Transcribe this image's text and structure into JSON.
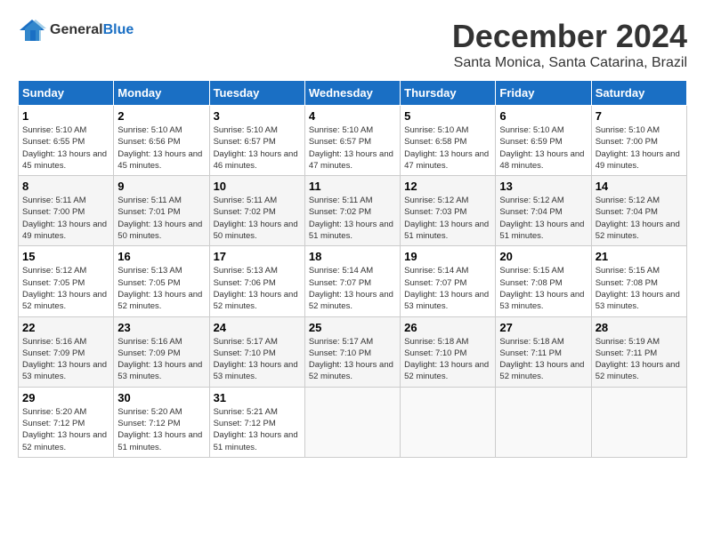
{
  "header": {
    "logo_general": "General",
    "logo_blue": "Blue",
    "title": "December 2024",
    "location": "Santa Monica, Santa Catarina, Brazil"
  },
  "calendar": {
    "days_of_week": [
      "Sunday",
      "Monday",
      "Tuesday",
      "Wednesday",
      "Thursday",
      "Friday",
      "Saturday"
    ],
    "weeks": [
      [
        {
          "day": "1",
          "sunrise": "5:10 AM",
          "sunset": "6:55 PM",
          "daylight": "13 hours and 45 minutes."
        },
        {
          "day": "2",
          "sunrise": "5:10 AM",
          "sunset": "6:56 PM",
          "daylight": "13 hours and 45 minutes."
        },
        {
          "day": "3",
          "sunrise": "5:10 AM",
          "sunset": "6:57 PM",
          "daylight": "13 hours and 46 minutes."
        },
        {
          "day": "4",
          "sunrise": "5:10 AM",
          "sunset": "6:57 PM",
          "daylight": "13 hours and 47 minutes."
        },
        {
          "day": "5",
          "sunrise": "5:10 AM",
          "sunset": "6:58 PM",
          "daylight": "13 hours and 47 minutes."
        },
        {
          "day": "6",
          "sunrise": "5:10 AM",
          "sunset": "6:59 PM",
          "daylight": "13 hours and 48 minutes."
        },
        {
          "day": "7",
          "sunrise": "5:10 AM",
          "sunset": "7:00 PM",
          "daylight": "13 hours and 49 minutes."
        }
      ],
      [
        {
          "day": "8",
          "sunrise": "5:11 AM",
          "sunset": "7:00 PM",
          "daylight": "13 hours and 49 minutes."
        },
        {
          "day": "9",
          "sunrise": "5:11 AM",
          "sunset": "7:01 PM",
          "daylight": "13 hours and 50 minutes."
        },
        {
          "day": "10",
          "sunrise": "5:11 AM",
          "sunset": "7:02 PM",
          "daylight": "13 hours and 50 minutes."
        },
        {
          "day": "11",
          "sunrise": "5:11 AM",
          "sunset": "7:02 PM",
          "daylight": "13 hours and 51 minutes."
        },
        {
          "day": "12",
          "sunrise": "5:12 AM",
          "sunset": "7:03 PM",
          "daylight": "13 hours and 51 minutes."
        },
        {
          "day": "13",
          "sunrise": "5:12 AM",
          "sunset": "7:04 PM",
          "daylight": "13 hours and 51 minutes."
        },
        {
          "day": "14",
          "sunrise": "5:12 AM",
          "sunset": "7:04 PM",
          "daylight": "13 hours and 52 minutes."
        }
      ],
      [
        {
          "day": "15",
          "sunrise": "5:12 AM",
          "sunset": "7:05 PM",
          "daylight": "13 hours and 52 minutes."
        },
        {
          "day": "16",
          "sunrise": "5:13 AM",
          "sunset": "7:05 PM",
          "daylight": "13 hours and 52 minutes."
        },
        {
          "day": "17",
          "sunrise": "5:13 AM",
          "sunset": "7:06 PM",
          "daylight": "13 hours and 52 minutes."
        },
        {
          "day": "18",
          "sunrise": "5:14 AM",
          "sunset": "7:07 PM",
          "daylight": "13 hours and 52 minutes."
        },
        {
          "day": "19",
          "sunrise": "5:14 AM",
          "sunset": "7:07 PM",
          "daylight": "13 hours and 53 minutes."
        },
        {
          "day": "20",
          "sunrise": "5:15 AM",
          "sunset": "7:08 PM",
          "daylight": "13 hours and 53 minutes."
        },
        {
          "day": "21",
          "sunrise": "5:15 AM",
          "sunset": "7:08 PM",
          "daylight": "13 hours and 53 minutes."
        }
      ],
      [
        {
          "day": "22",
          "sunrise": "5:16 AM",
          "sunset": "7:09 PM",
          "daylight": "13 hours and 53 minutes."
        },
        {
          "day": "23",
          "sunrise": "5:16 AM",
          "sunset": "7:09 PM",
          "daylight": "13 hours and 53 minutes."
        },
        {
          "day": "24",
          "sunrise": "5:17 AM",
          "sunset": "7:10 PM",
          "daylight": "13 hours and 53 minutes."
        },
        {
          "day": "25",
          "sunrise": "5:17 AM",
          "sunset": "7:10 PM",
          "daylight": "13 hours and 52 minutes."
        },
        {
          "day": "26",
          "sunrise": "5:18 AM",
          "sunset": "7:10 PM",
          "daylight": "13 hours and 52 minutes."
        },
        {
          "day": "27",
          "sunrise": "5:18 AM",
          "sunset": "7:11 PM",
          "daylight": "13 hours and 52 minutes."
        },
        {
          "day": "28",
          "sunrise": "5:19 AM",
          "sunset": "7:11 PM",
          "daylight": "13 hours and 52 minutes."
        }
      ],
      [
        {
          "day": "29",
          "sunrise": "5:20 AM",
          "sunset": "7:12 PM",
          "daylight": "13 hours and 52 minutes."
        },
        {
          "day": "30",
          "sunrise": "5:20 AM",
          "sunset": "7:12 PM",
          "daylight": "13 hours and 51 minutes."
        },
        {
          "day": "31",
          "sunrise": "5:21 AM",
          "sunset": "7:12 PM",
          "daylight": "13 hours and 51 minutes."
        },
        null,
        null,
        null,
        null
      ]
    ]
  }
}
